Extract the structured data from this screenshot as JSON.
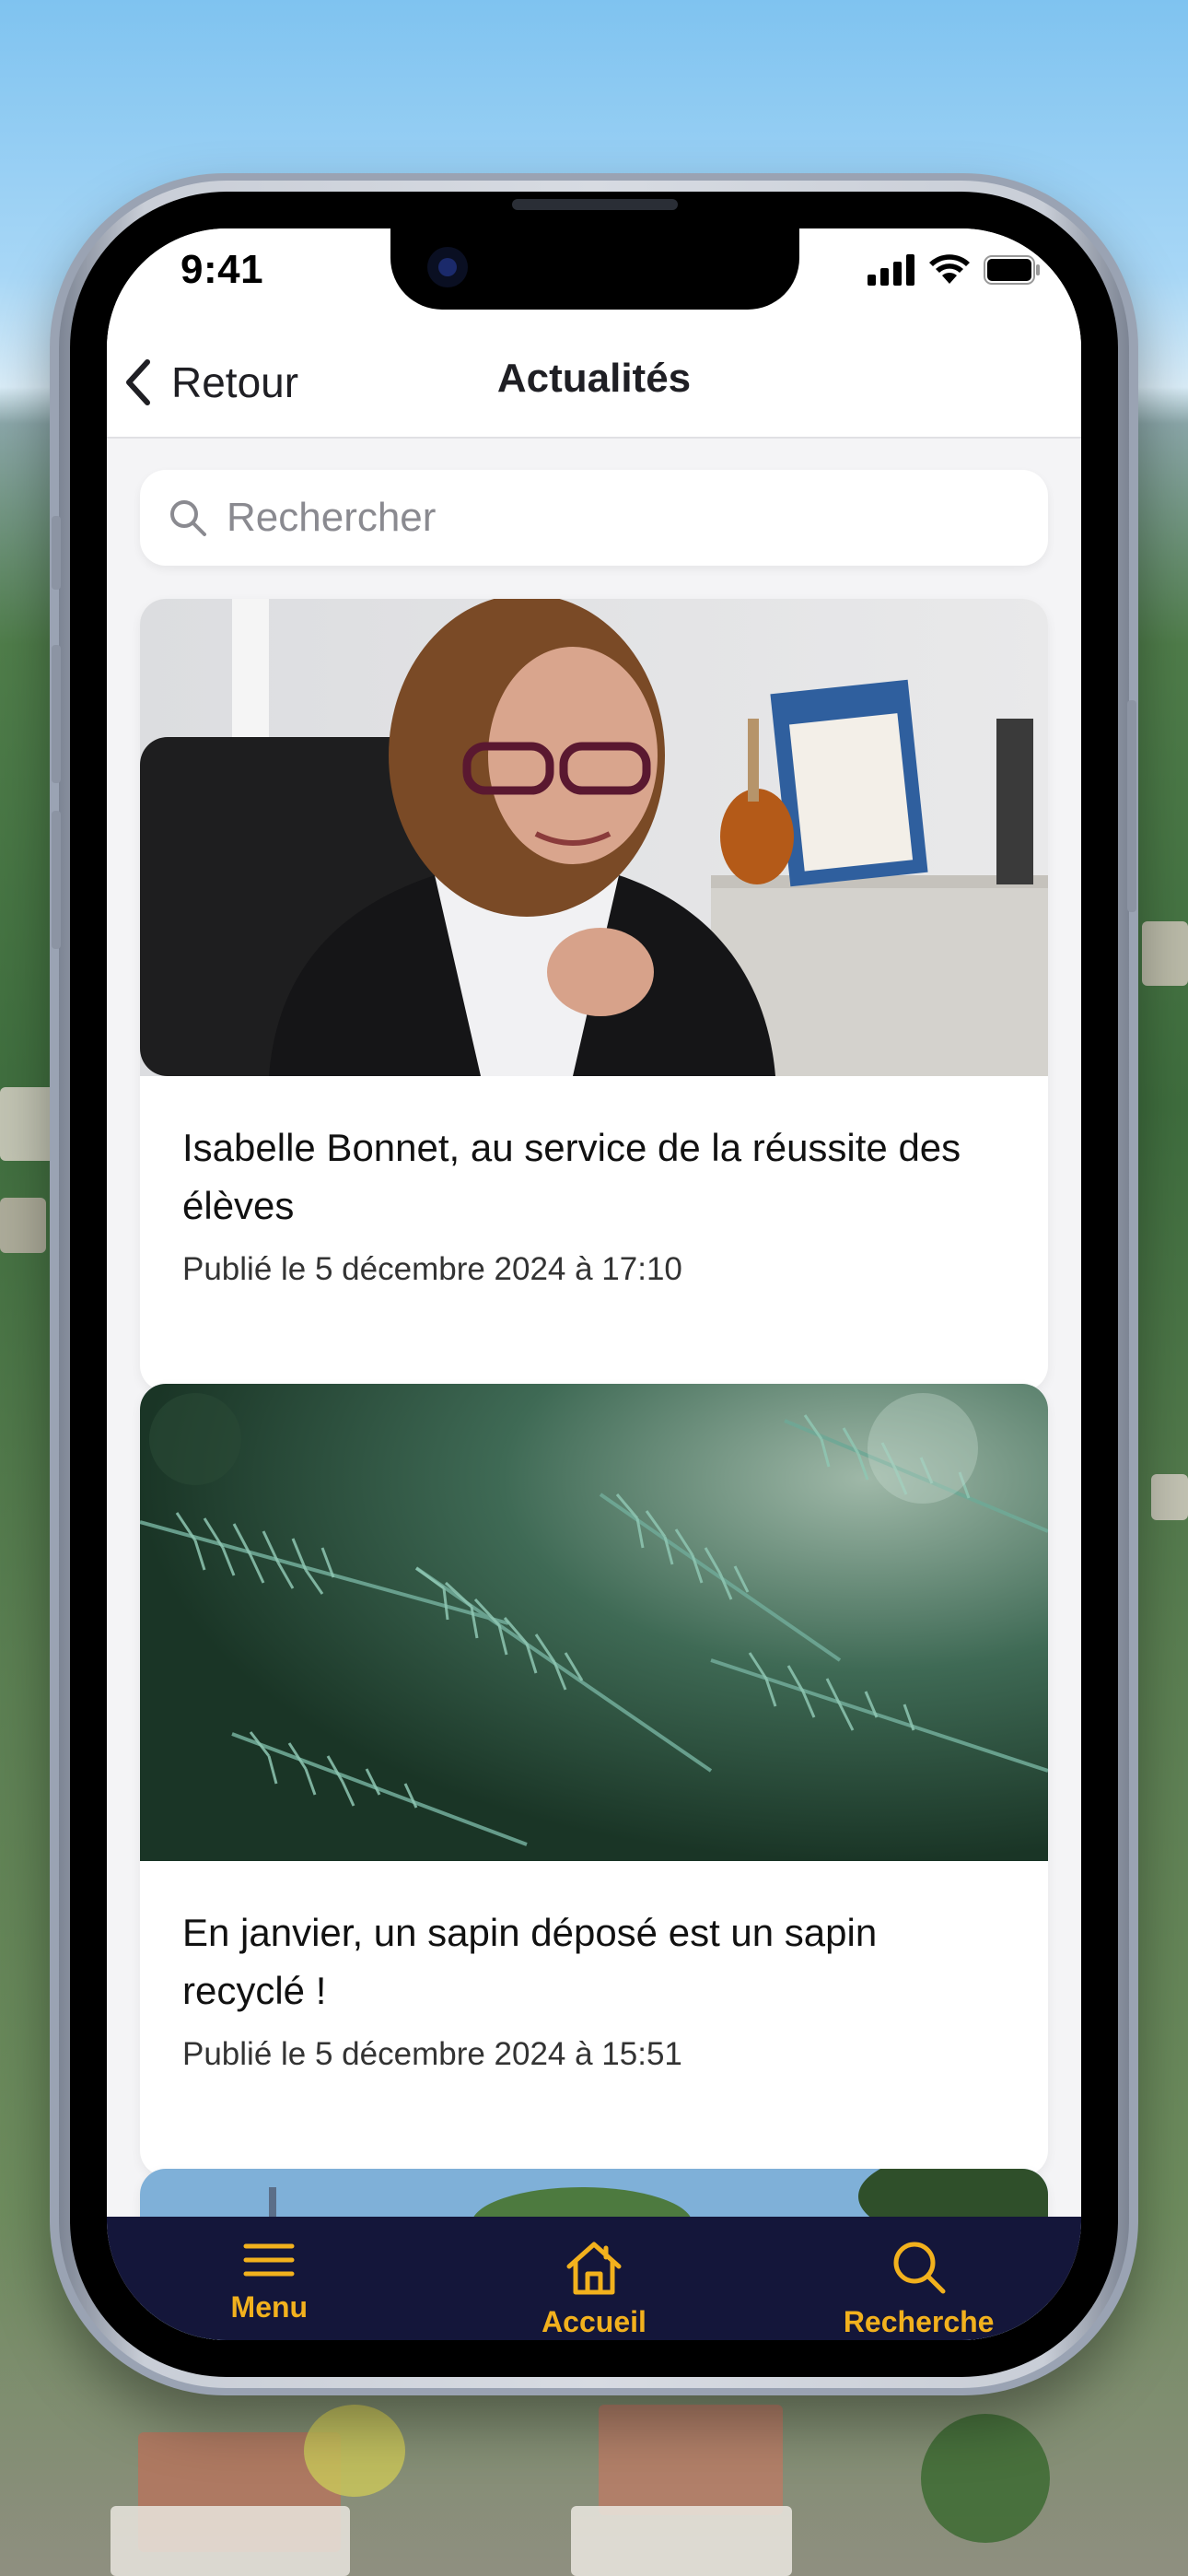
{
  "status_bar": {
    "time": "9:41"
  },
  "nav": {
    "back_label": "Retour",
    "title": "Actualités"
  },
  "search": {
    "placeholder": "Rechercher"
  },
  "articles": [
    {
      "title": "Isabelle Bonnet, au service de la réussite des élèves",
      "date": "Publié le 5 décembre 2024 à 17:10",
      "image": "portrait-photo"
    },
    {
      "title": "En janvier, un sapin déposé est un sapin recyclé !",
      "date": "Publié le 5 décembre 2024 à 15:51",
      "image": "fir-branch-photo"
    },
    {
      "title": "",
      "date": "",
      "image": "outdoor-photo"
    }
  ],
  "tabs": [
    {
      "label": "Menu",
      "icon": "hamburger-icon"
    },
    {
      "label": "Accueil",
      "icon": "home-icon"
    },
    {
      "label": "Recherche",
      "icon": "search-icon"
    }
  ],
  "colors": {
    "tab_bar_bg": "#14163a",
    "accent": "#f2b11d",
    "screen_bg": "#f4f4f6"
  }
}
